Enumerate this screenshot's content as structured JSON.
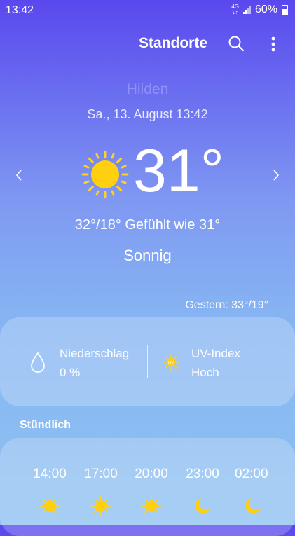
{
  "status_bar": {
    "time": "13:42",
    "network": "4G",
    "battery": "60%"
  },
  "header": {
    "title": "Standorte"
  },
  "location": {
    "name": "Hilden"
  },
  "date": "Sa., 13. August 13:42",
  "current": {
    "temperature": "31°",
    "min_max_feels": "32°/18° Gefühlt wie 31°",
    "condition": "Sonnig",
    "icon": "sun-icon"
  },
  "yesterday": "Gestern: 33°/19°",
  "details": {
    "precipitation": {
      "label": "Niederschlag",
      "value": "0 %",
      "icon": "drop-icon"
    },
    "uv": {
      "label": "UV-Index",
      "value": "Hoch",
      "icon": "uv-icon"
    }
  },
  "hourly": {
    "heading": "Stündlich",
    "items": [
      {
        "time": "14:00",
        "icon": "sun-icon"
      },
      {
        "time": "17:00",
        "icon": "sun-icon"
      },
      {
        "time": "20:00",
        "icon": "sun-icon"
      },
      {
        "time": "23:00",
        "icon": "moon-icon"
      },
      {
        "time": "02:00",
        "icon": "moon-icon"
      }
    ]
  },
  "colors": {
    "sun": "#ffd21f",
    "sun_core": "#ffcf10"
  }
}
